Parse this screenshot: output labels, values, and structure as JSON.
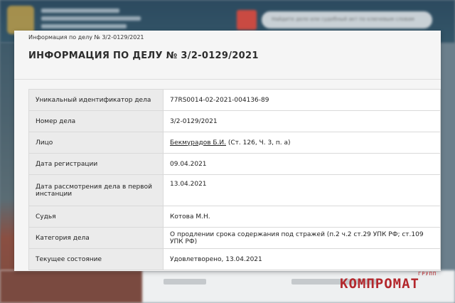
{
  "background": {
    "search_placeholder": "Найдите дело или судебный акт по ключевым словам"
  },
  "breadcrumb": "Информация по делу № 3/2-0129/2021",
  "title": "ИНФОРМАЦИЯ ПО ДЕЛУ № 3/2-0129/2021",
  "rows": [
    {
      "label": "Уникальный идентификатор дела",
      "value": "77RS0014-02-2021-004136-89"
    },
    {
      "label": "Номер дела",
      "value": "3/2-0129/2021"
    },
    {
      "label": "Лицо",
      "value_link": "Бекмурадов Б.И.",
      "value": "(Ст. 126, Ч. 3, п. а)"
    },
    {
      "label": "Дата регистрации",
      "value": "09.04.2021"
    },
    {
      "label": "Дата рассмотрения дела в первой инстанции",
      "value": "13.04.2021"
    },
    {
      "label": "Судья",
      "value": "Котова М.Н."
    },
    {
      "label": "Категория дела",
      "value": "О продлении срока содержания под стражей (п.2 ч.2 ст.29 УПК РФ; ст.109 УПК РФ)"
    },
    {
      "label": "Текущее состояние",
      "value": "Удовлетворено, 13.04.2021"
    }
  ],
  "watermark": {
    "main": "КОМПРОМАТ",
    "sub": "ГРУПП"
  },
  "colors": {
    "panel": "#f5f5f5",
    "label_cell": "#ebebeb",
    "watermark": "#b3282d",
    "header": "#2c4a5f"
  }
}
